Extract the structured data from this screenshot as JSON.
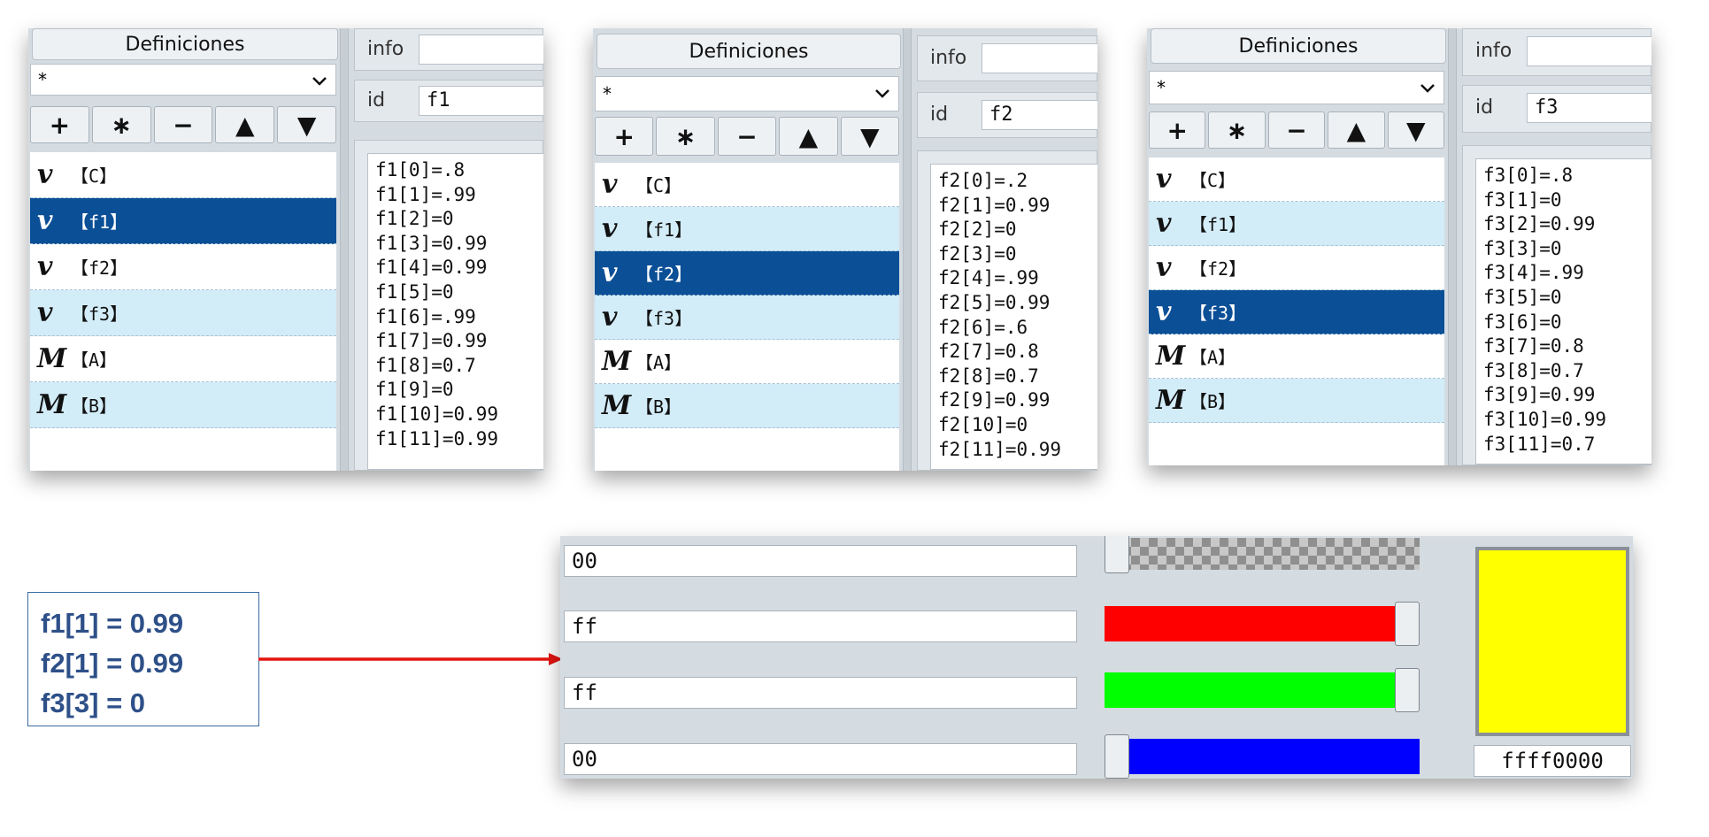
{
  "definitions_title": "Definiciones",
  "filter_value": "*",
  "toolbar": {
    "add": "+",
    "star": "∗",
    "remove": "−",
    "up": "▲",
    "down": "▼"
  },
  "field_labels": {
    "info": "info",
    "id": "id"
  },
  "icons": {
    "var": "v",
    "module": "M"
  },
  "panels": [
    {
      "id_value": "f1",
      "selected": "f1",
      "items": [
        {
          "type": "var",
          "label": "【C】"
        },
        {
          "type": "var",
          "label": "【f1】"
        },
        {
          "type": "var",
          "label": "【f2】"
        },
        {
          "type": "var",
          "label": "【f3】"
        },
        {
          "type": "module",
          "label": "【A】"
        },
        {
          "type": "module",
          "label": "【B】"
        }
      ],
      "code": [
        "f1[0]=.8",
        "f1[1]=.99",
        "f1[2]=0",
        "f1[3]=0.99",
        "f1[4]=0.99",
        "f1[5]=0",
        "f1[6]=.99",
        "f1[7]=0.99",
        "f1[8]=0.7",
        "f1[9]=0",
        "f1[10]=0.99",
        "f1[11]=0.99"
      ]
    },
    {
      "id_value": "f2",
      "selected": "f2",
      "items": [
        {
          "type": "var",
          "label": "【C】"
        },
        {
          "type": "var",
          "label": "【f1】"
        },
        {
          "type": "var",
          "label": "【f2】"
        },
        {
          "type": "var",
          "label": "【f3】"
        },
        {
          "type": "module",
          "label": "【A】"
        },
        {
          "type": "module",
          "label": "【B】"
        }
      ],
      "code": [
        "f2[0]=.2",
        "f2[1]=0.99",
        "f2[2]=0",
        "f2[3]=0",
        "f2[4]=.99",
        "f2[5]=0.99",
        "f2[6]=.6",
        "f2[7]=0.8",
        "f2[8]=0.7",
        "f2[9]=0.99",
        "f2[10]=0",
        "f2[11]=0.99"
      ]
    },
    {
      "id_value": "f3",
      "selected": "f3",
      "items": [
        {
          "type": "var",
          "label": "【C】"
        },
        {
          "type": "var",
          "label": "【f1】"
        },
        {
          "type": "var",
          "label": "【f2】"
        },
        {
          "type": "var",
          "label": "【f3】"
        },
        {
          "type": "module",
          "label": "【A】"
        },
        {
          "type": "module",
          "label": "【B】"
        }
      ],
      "code": [
        "f3[0]=.8",
        "f3[1]=0",
        "f3[2]=0.99",
        "f3[3]=0",
        "f3[4]=.99",
        "f3[5]=0",
        "f3[6]=0",
        "f3[7]=0.8",
        "f3[8]=0.7",
        "f3[9]=0.99",
        "f3[10]=0.99",
        "f3[11]=0.7"
      ]
    }
  ],
  "note_lines": [
    "f1[1] = 0.99",
    "f2[1] = 0.99",
    "f3[3] = 0"
  ],
  "arrow_color": "#e3140f",
  "color_picker": {
    "channels": [
      {
        "name": "alpha",
        "hex": "00",
        "level": 0.0,
        "color": "checker"
      },
      {
        "name": "red",
        "hex": "ff",
        "level": 1.0,
        "color": "#ff0000"
      },
      {
        "name": "green",
        "hex": "ff",
        "level": 1.0,
        "color": "#00ff00"
      },
      {
        "name": "blue",
        "hex": "00",
        "level": 0.0,
        "color": "#0000ff"
      }
    ],
    "swatch_color": "#ffff00",
    "hex_value": "ffff0000"
  }
}
